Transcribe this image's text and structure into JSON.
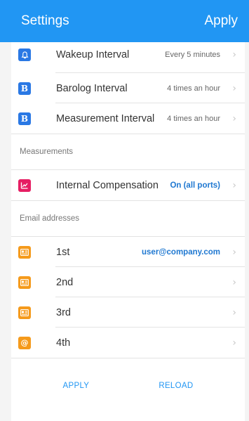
{
  "header": {
    "title": "Settings",
    "apply": "Apply"
  },
  "general": [
    {
      "label": "Wakeup Interval",
      "value": "Every 5 minutes",
      "icon": "bell-icon"
    },
    {
      "label": "Barolog Interval",
      "value": "4 times an hour",
      "icon": "b-icon",
      "glyph": "B"
    },
    {
      "label": "Measurement Interval",
      "value": "4 times an hour",
      "icon": "b-icon",
      "glyph": "B"
    }
  ],
  "measurements": {
    "title": "Measurements",
    "items": [
      {
        "label": "Internal Compensation",
        "value": "On (all ports)",
        "icon": "chart-line-icon"
      }
    ]
  },
  "emails": {
    "title": "Email addresses",
    "items": [
      {
        "label": "1st",
        "value": "user@company.com",
        "icon": "contact-card-icon"
      },
      {
        "label": "2nd",
        "value": "",
        "icon": "contact-card-icon"
      },
      {
        "label": "3rd",
        "value": "",
        "icon": "contact-card-icon"
      },
      {
        "label": "4th",
        "value": "",
        "icon": "at-sign-icon"
      }
    ]
  },
  "footer": {
    "apply": "APPLY",
    "reload": "RELOAD"
  },
  "colors": {
    "primary": "#2196f3",
    "pink": "#e61e63",
    "orange": "#f59a1b"
  }
}
